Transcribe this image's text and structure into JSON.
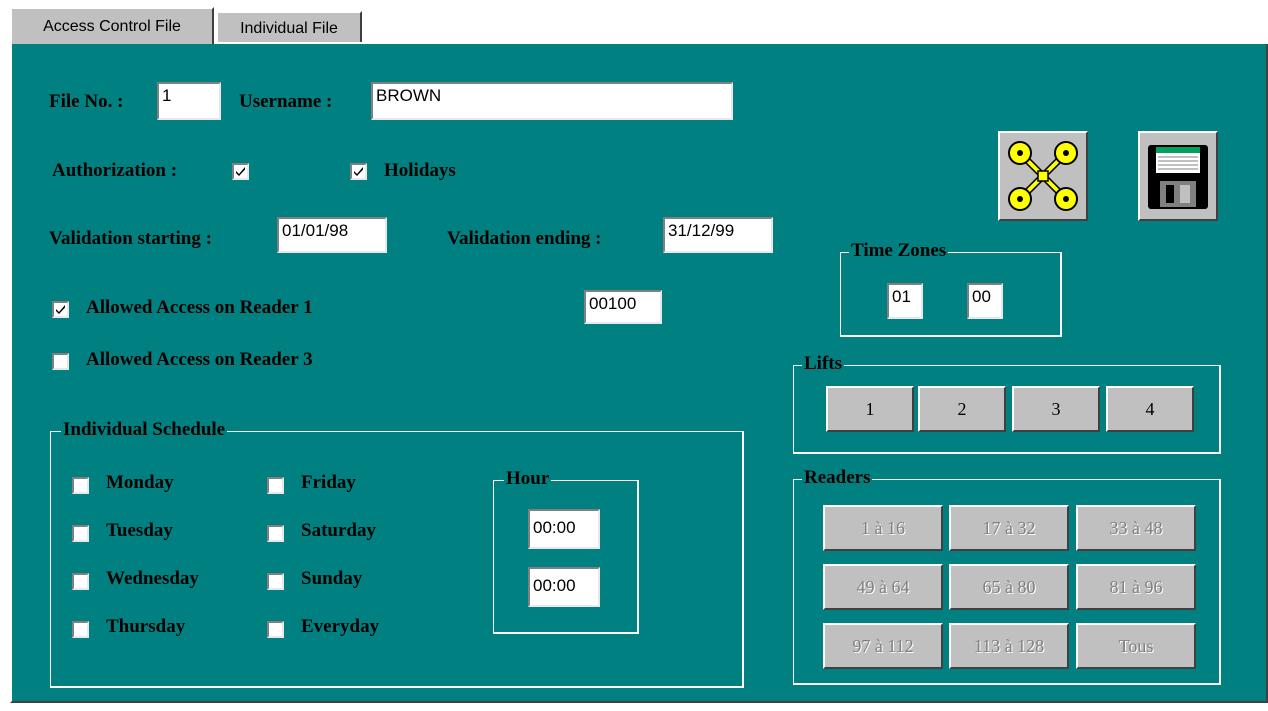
{
  "tabs": [
    {
      "label": "Access Control File",
      "active": true
    },
    {
      "label": "Individual File",
      "active": false
    }
  ],
  "file": {
    "file_no_label": "File No. :",
    "file_no_value": "1",
    "username_label": "Username :",
    "username_value": "BROWN"
  },
  "authorization": {
    "label": "Authorization :",
    "checked": true
  },
  "holidays": {
    "label": "Holidays",
    "checked": true
  },
  "validation": {
    "start_label": "Validation starting :",
    "start_value": "01/01/98",
    "end_label": "Validation ending :",
    "end_value": "31/12/99"
  },
  "readers_access": [
    {
      "label": "Allowed Access on Reader 1",
      "checked": true,
      "code": "00100"
    },
    {
      "label": "Allowed Access on Reader 3",
      "checked": false
    }
  ],
  "schedule": {
    "title": "Individual Schedule",
    "days_col1": [
      {
        "label": "Monday",
        "checked": false
      },
      {
        "label": "Tuesday",
        "checked": false
      },
      {
        "label": "Wednesday",
        "checked": false
      },
      {
        "label": "Thursday",
        "checked": false
      }
    ],
    "days_col2": [
      {
        "label": "Friday",
        "checked": false
      },
      {
        "label": "Saturday",
        "checked": false
      },
      {
        "label": "Sunday",
        "checked": false
      },
      {
        "label": "Everyday",
        "checked": false
      }
    ],
    "hour": {
      "title": "Hour",
      "from": "00:00",
      "to": "00:00"
    }
  },
  "time_zones": {
    "title": "Time Zones",
    "values": [
      "01",
      "00"
    ]
  },
  "lifts": {
    "title": "Lifts",
    "buttons": [
      "1",
      "2",
      "3",
      "4"
    ]
  },
  "readers": {
    "title": "Readers",
    "buttons": [
      "1 à 16",
      "17 à 32",
      "33 à 48",
      "49 à 64",
      "65 à 80",
      "81 à 96",
      "97 à 112",
      "113 à 128",
      "Tous"
    ],
    "enabled": false
  },
  "icons": {
    "keys": "keys-icon",
    "save": "floppy-disk-icon"
  },
  "colors": {
    "panel": "#008080",
    "button": "#c0c0c0",
    "key_yellow": "#ffff00"
  }
}
